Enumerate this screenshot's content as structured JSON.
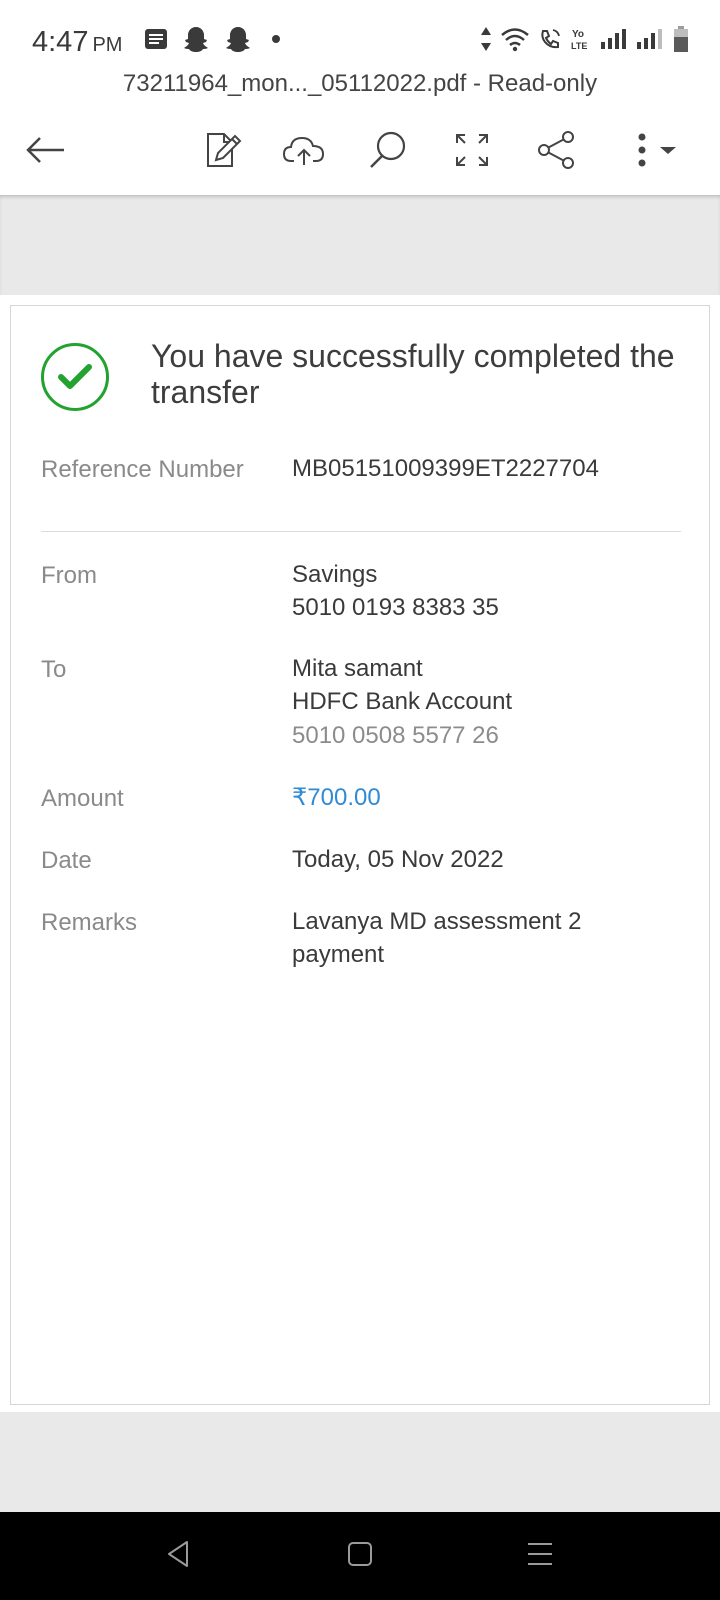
{
  "status_bar": {
    "time": "4:47",
    "ampm": "PM",
    "icons": [
      "notification-list-icon",
      "snapchat-icon",
      "snapchat-icon",
      "dot-icon",
      "data-arrows-icon",
      "wifi-icon",
      "wifi-calling-icon",
      "volte-icon",
      "signal-icon",
      "signal-icon",
      "battery-icon"
    ],
    "volte_label": "Yo\nLTE"
  },
  "document": {
    "filename": "73211964_mon..._05112022.pdf - Read-only"
  },
  "toolbar": {
    "icons": [
      "back-arrow-icon",
      "edit-document-icon",
      "cloud-upload-icon",
      "search-icon",
      "fullscreen-icon",
      "share-icon",
      "more-options-icon"
    ]
  },
  "receipt": {
    "headline": "You have successfully completed the transfer",
    "reference_label": "Reference Number",
    "reference_value": "MB05151009399ET2227704",
    "from_label": "From",
    "from_account_type": "Savings",
    "from_account_number": "5010 0193 8383 35",
    "to_label": "To",
    "to_name": "Mita samant",
    "to_bank": "HDFC Bank Account",
    "to_account_number": "5010 0508 5577 26",
    "amount_label": "Amount",
    "amount_value": "₹700.00",
    "date_label": "Date",
    "date_value": "Today, 05 Nov 2022",
    "remarks_label": "Remarks",
    "remarks_value": "Lavanya MD assessment 2 payment"
  },
  "colors": {
    "success_green": "#22a22e",
    "amount_blue": "#2f8bd6",
    "label_grey": "#8a8a8a"
  },
  "nav_bar": {
    "icons": [
      "back-triangle-icon",
      "home-square-icon",
      "recents-menu-icon"
    ]
  }
}
